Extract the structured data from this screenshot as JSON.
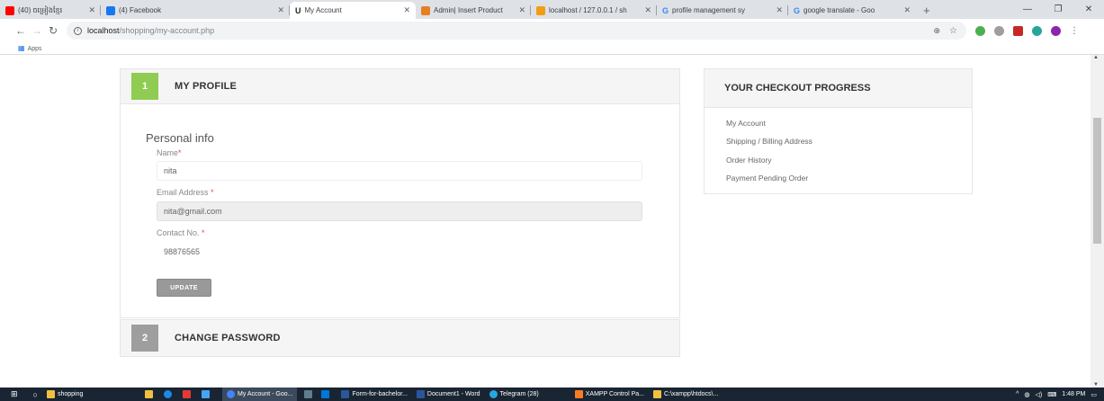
{
  "browser": {
    "tabs": [
      {
        "title": "(40) ចម្រៀងខ្មែរ",
        "favicon_color": "#ff0000",
        "active": false
      },
      {
        "title": "(4) Facebook",
        "favicon_color": "#1877f2",
        "active": false
      },
      {
        "title": "My Account",
        "favicon_color": "#222222",
        "active": true
      },
      {
        "title": "Admin| Insert Product",
        "favicon_color": "#e67e22",
        "active": false
      },
      {
        "title": "localhost / 127.0.0.1 / sh",
        "favicon_color": "#f39c12",
        "active": false
      },
      {
        "title": "profile management sy",
        "favicon_color": "#4285f4",
        "active": false
      },
      {
        "title": "google translate - Goo",
        "favicon_color": "#4285f4",
        "active": false
      }
    ],
    "new_tab": "+",
    "window_controls": [
      "—",
      "❐",
      "✕"
    ],
    "url_host": "localhost",
    "url_path": "/shopping/my-account.php",
    "bookmarks_label": "Apps"
  },
  "profile": {
    "step_number": "1",
    "title": "MY PROFILE",
    "section_title": "Personal info",
    "name_label": "Name",
    "name_value": "nita",
    "email_label": "Email Address ",
    "email_value": "nita@gmail.com",
    "contact_label": "Contact No. ",
    "contact_value": "98876565",
    "required_mark": "*",
    "update_button": "UPDATE"
  },
  "password": {
    "step_number": "2",
    "title": "CHANGE PASSWORD"
  },
  "checkout": {
    "title": "YOUR CHECKOUT PROGRESS",
    "items": [
      "My Account",
      "Shipping / Billing Address",
      "Order History",
      "Payment Pending Order"
    ]
  },
  "taskbar": {
    "search_placeholder": "shopping",
    "items": [
      {
        "label": "My Account - Goo...",
        "color": "#4285f4",
        "active": true
      },
      {
        "label": "Form-for-bachelor...",
        "color": "#2b579a",
        "active": false
      },
      {
        "label": "Document1 - Word",
        "color": "#2b579a",
        "active": false
      },
      {
        "label": "Telegram (28)",
        "color": "#2aa3df",
        "active": false
      },
      {
        "label": "XAMPP Control Pa...",
        "color": "#fb7a24",
        "active": false
      },
      {
        "label": "C:\\xampp\\htdocs\\...",
        "color": "#f0c040",
        "active": false
      }
    ],
    "time": "1:48 PM"
  },
  "colors": {
    "accent_green": "#8fcc51",
    "step_gray": "#9e9e9e"
  }
}
